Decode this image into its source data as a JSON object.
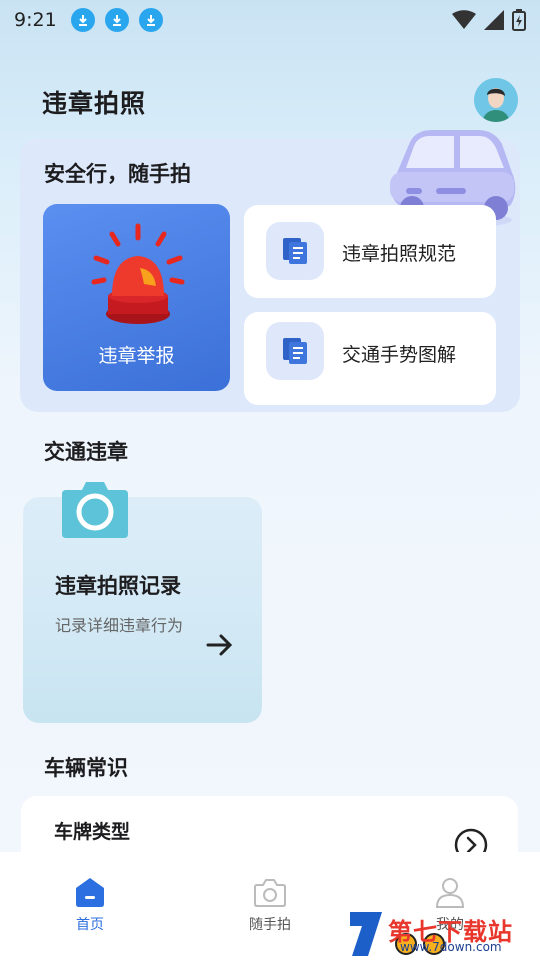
{
  "status_bar": {
    "time": "9:21"
  },
  "header": {
    "title": "违章拍照"
  },
  "safe_section": {
    "title": "安全行，随手拍",
    "report_label": "违章举报",
    "cards": [
      {
        "label": "违章拍照规范"
      },
      {
        "label": "交通手势图解"
      }
    ]
  },
  "violation_section": {
    "title": "交通违章",
    "record_title": "违章拍照记录",
    "record_subtitle": "记录详细违章行为"
  },
  "knowledge_section": {
    "title": "车辆常识",
    "plate_title": "车牌类型"
  },
  "bottom_nav": {
    "items": [
      {
        "label": "首页",
        "active": true
      },
      {
        "label": "随手拍",
        "active": false
      },
      {
        "label": "我的",
        "active": false
      }
    ]
  },
  "watermark": {
    "text": "第七下载站",
    "url": "www.7down.com"
  },
  "colors": {
    "accent": "#2c6fe0",
    "report_card": "#4a7fe4",
    "panel": "#dde9fb"
  }
}
